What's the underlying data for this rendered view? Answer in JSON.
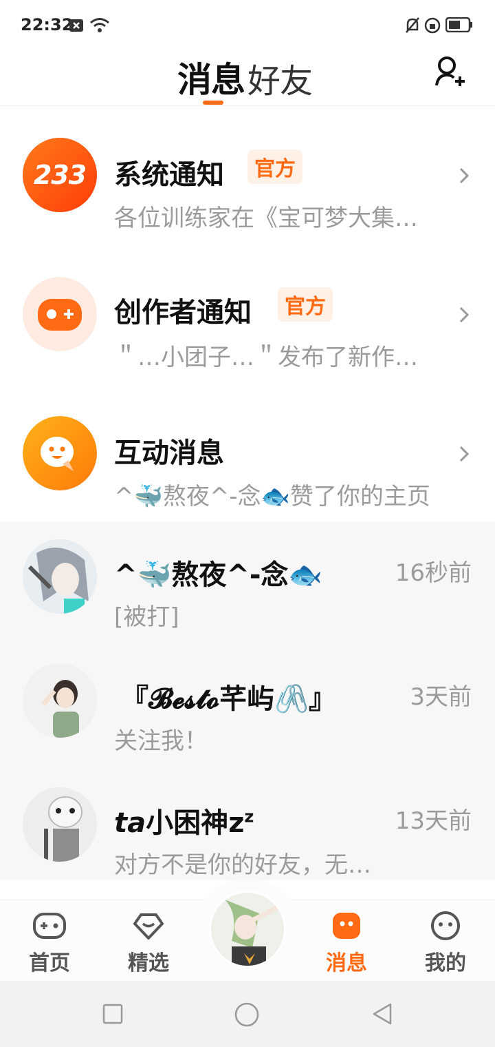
{
  "status": {
    "time": "22:32"
  },
  "header": {
    "tab_messages": "消息",
    "tab_friends": "好友"
  },
  "official": [
    {
      "title": "系统通知",
      "badge": "官方",
      "subtitle": "各位训练家在《宝可梦大集…",
      "avatar_icon": "233-logo-icon",
      "avatar_text": "233"
    },
    {
      "title": "创作者通知",
      "badge": "官方",
      "subtitle": "＂…小团子…＂发布了新作…",
      "avatar_icon": "gamepad-icon"
    },
    {
      "title": "互动消息",
      "subtitle": "^🐳熬夜^-念🐟赞了你的主页",
      "avatar_icon": "chat-bubble-icon"
    }
  ],
  "chats": [
    {
      "name": "^🐳熬夜^-念🐟",
      "preview": "[被打]",
      "time": "16秒前"
    },
    {
      "name": "『𝓑𝓮𝓼𝓽𝓸芊屿🖇️』",
      "preview": "关注我！",
      "time": "3天前"
    },
    {
      "name": "ta小困神zᶻ",
      "name_prefix": "ta",
      "name_rest": "小困神z",
      "name_sup": "z",
      "preview": "对方不是你的好友，无…",
      "time": "13天前"
    }
  ],
  "bottom_nav": [
    {
      "label": "首页",
      "icon": "gamepad-outline-icon"
    },
    {
      "label": "精选",
      "icon": "heart-diamond-icon"
    },
    {
      "label": "消息",
      "icon": "message-icon",
      "active": true
    },
    {
      "label": "我的",
      "icon": "face-icon"
    }
  ],
  "colors": {
    "accent": "#ff6a13",
    "muted": "#9b9b9b",
    "chat_bg": "#f7f7f7"
  }
}
